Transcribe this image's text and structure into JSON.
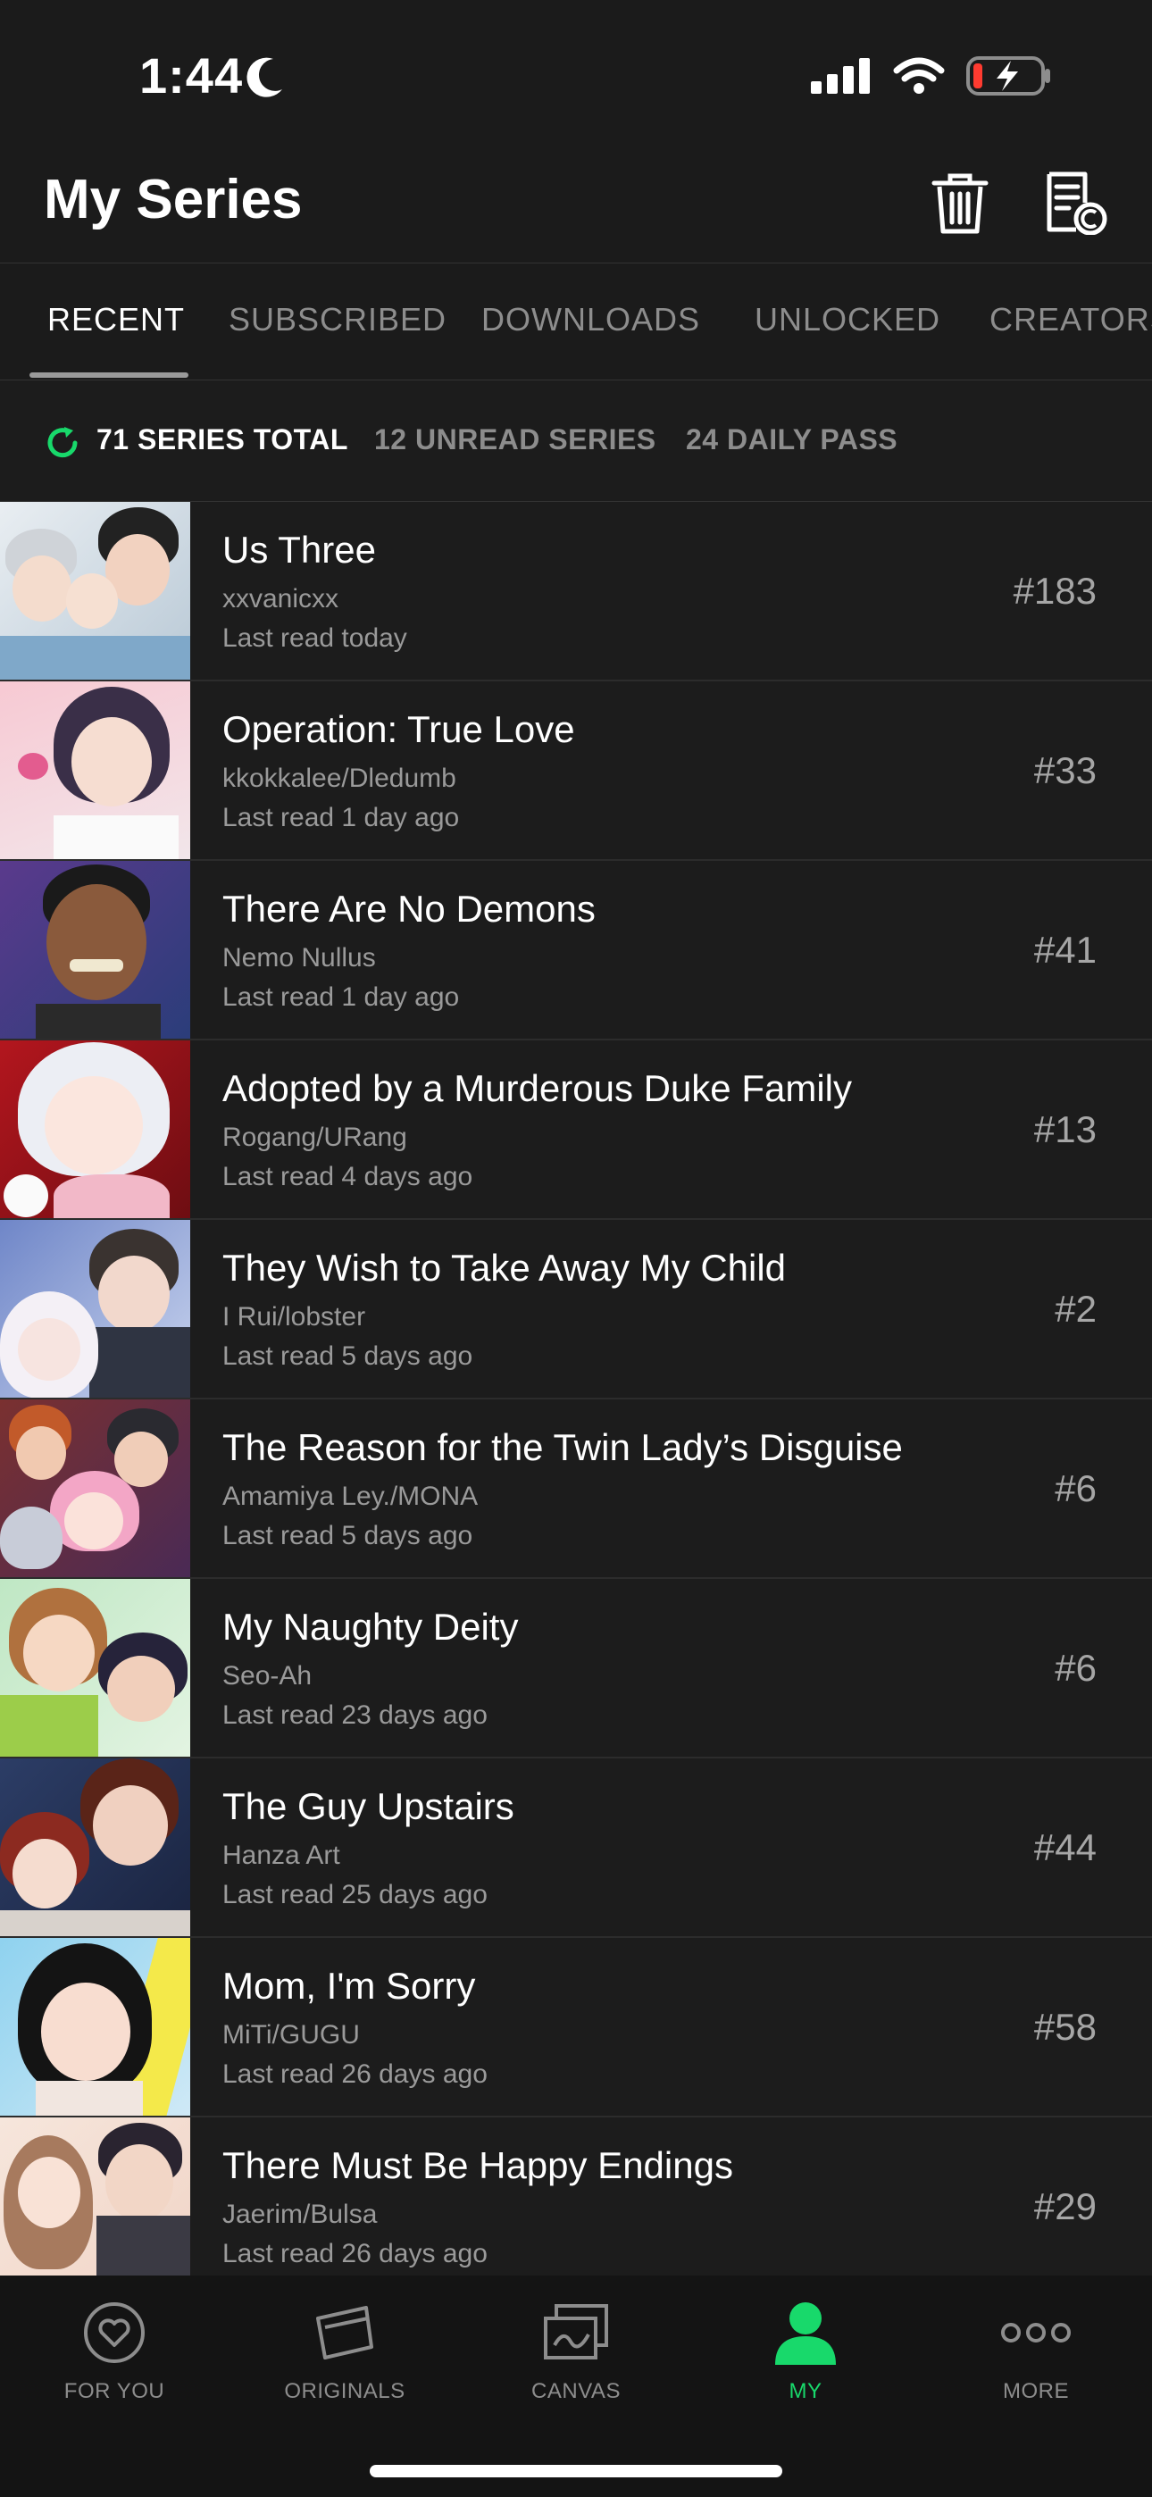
{
  "status_bar": {
    "time": "1:44",
    "icons": [
      "moon-icon",
      "signal-icon",
      "wifi-icon",
      "battery-charging-icon"
    ]
  },
  "header": {
    "title": "My Series",
    "icons": [
      "trash-icon",
      "history-document-icon"
    ]
  },
  "tabs": [
    {
      "label": "RECENT",
      "active": true
    },
    {
      "label": "SUBSCRIBED",
      "active": false
    },
    {
      "label": "DOWNLOADS",
      "active": false
    },
    {
      "label": "UNLOCKED",
      "active": false
    },
    {
      "label": "CREATORS",
      "active": false
    }
  ],
  "filters": [
    {
      "label": "71 SERIES TOTAL",
      "active": true
    },
    {
      "label": "12 UNREAD SERIES",
      "active": false
    },
    {
      "label": "24 DAILY PASS",
      "active": false
    }
  ],
  "series": [
    {
      "title": "Us Three",
      "author": "xxvanicxx",
      "last_read": "Last read today",
      "episode": "#183"
    },
    {
      "title": "Operation: True Love",
      "author": "kkokkalee/Dledumb",
      "last_read": "Last read 1 day ago",
      "episode": "#33"
    },
    {
      "title": "There Are No Demons",
      "author": "Nemo Nullus",
      "last_read": "Last read 1 day ago",
      "episode": "#41"
    },
    {
      "title": "Adopted by a Murderous Duke Family",
      "author": "Rogang/URang",
      "last_read": "Last read 4 days ago",
      "episode": "#13"
    },
    {
      "title": "They Wish to Take Away My Child",
      "author": "I Rui/lobster",
      "last_read": "Last read 5 days ago",
      "episode": "#2"
    },
    {
      "title": "The Reason for the Twin Lady’s Disguise",
      "author": "Amamiya Ley./MONA",
      "last_read": "Last read 5 days ago",
      "episode": "#6"
    },
    {
      "title": "My Naughty Deity",
      "author": "Seo-Ah",
      "last_read": "Last read 23 days ago",
      "episode": "#6"
    },
    {
      "title": "The Guy Upstairs",
      "author": "Hanza Art",
      "last_read": "Last read 25 days ago",
      "episode": "#44"
    },
    {
      "title": "Mom, I'm Sorry",
      "author": "MiTi/GUGU",
      "last_read": "Last read 26 days ago",
      "episode": "#58"
    },
    {
      "title": "There Must Be Happy Endings",
      "author": "Jaerim/Bulsa",
      "last_read": "Last read 26 days ago",
      "episode": "#29"
    }
  ],
  "bottom_nav": [
    {
      "label": "FOR YOU",
      "icon": "heart-circle-icon",
      "active": false
    },
    {
      "label": "ORIGINALS",
      "icon": "originals-icon",
      "active": false
    },
    {
      "label": "CANVAS",
      "icon": "canvas-icon",
      "active": false
    },
    {
      "label": "MY",
      "icon": "person-icon",
      "active": true
    },
    {
      "label": "MORE",
      "icon": "more-dots-icon",
      "active": false
    }
  ],
  "colors": {
    "accent": "#18d96b",
    "background": "#1c1c1c",
    "text_muted": "#9a9a9a"
  }
}
